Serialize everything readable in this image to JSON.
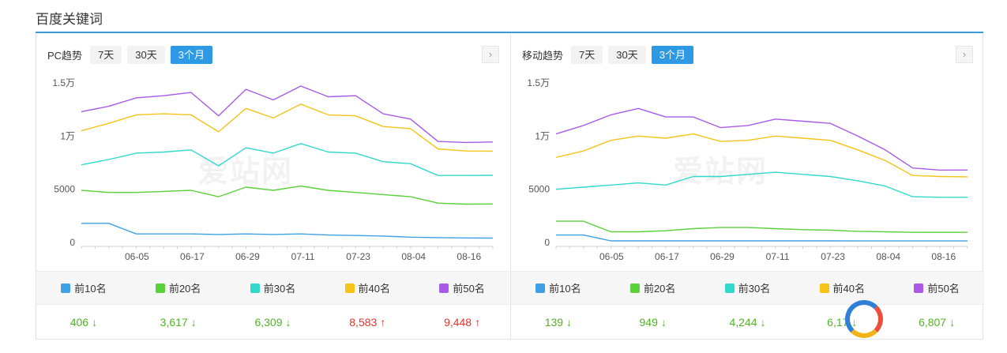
{
  "section": {
    "title": "百度关键词"
  },
  "panels": {
    "pc": {
      "label": "PC趋势",
      "ranges": [
        "7天",
        "30天",
        "3个月"
      ],
      "active_range": "3个月",
      "next_icon": "chevron-right-icon",
      "watermark": "爱站网",
      "legend": [
        "前10名",
        "前20名",
        "前30名",
        "前40名",
        "前50名"
      ],
      "values": [
        {
          "value": "406",
          "trend": "down"
        },
        {
          "value": "3,617",
          "trend": "down"
        },
        {
          "value": "6,309",
          "trend": "down"
        },
        {
          "value": "8,583",
          "trend": "up"
        },
        {
          "value": "9,448",
          "trend": "up"
        }
      ]
    },
    "mobile": {
      "label": "移动趋势",
      "ranges": [
        "7天",
        "30天",
        "3个月"
      ],
      "active_range": "3个月",
      "next_icon": "chevron-right-icon",
      "watermark": "爱站网",
      "legend": [
        "前10名",
        "前20名",
        "前30名",
        "前40名",
        "前50名"
      ],
      "values": [
        {
          "value": "139",
          "trend": "down"
        },
        {
          "value": "949",
          "trend": "down"
        },
        {
          "value": "4,244",
          "trend": "down"
        },
        {
          "value": "6,17",
          "trend": "down"
        },
        {
          "value": "6,807",
          "trend": "down"
        }
      ]
    }
  },
  "colors": {
    "top10": "#3fa0e6",
    "top20": "#5ad03a",
    "top30": "#33d8cc",
    "top40": "#f6c318",
    "top50": "#a95ae6",
    "down": "#52b226",
    "up": "#e8312a",
    "active": "#2e9ae6"
  },
  "chart_data": [
    {
      "type": "line",
      "title": "PC趋势",
      "x_ticks": [
        "06-05",
        "06-17",
        "06-29",
        "07-11",
        "07-23",
        "08-04",
        "08-16"
      ],
      "y_ticks": [
        "0",
        "5000",
        "1万",
        "1.5万"
      ],
      "ylim": [
        0,
        15000
      ],
      "x": [
        0,
        6,
        12,
        18,
        24,
        30,
        36,
        42,
        48,
        54,
        60,
        66,
        72,
        78,
        84,
        90
      ],
      "series": [
        {
          "name": "前10名",
          "values": [
            1800,
            1800,
            800,
            800,
            800,
            750,
            800,
            750,
            800,
            700,
            650,
            600,
            500,
            450,
            420,
            406
          ]
        },
        {
          "name": "前20名",
          "values": [
            4900,
            4700,
            4700,
            4800,
            4900,
            4300,
            5200,
            4900,
            5300,
            4900,
            4700,
            4500,
            4300,
            3700,
            3600,
            3617
          ]
        },
        {
          "name": "前30名",
          "values": [
            7300,
            7800,
            8400,
            8500,
            8700,
            7200,
            8900,
            8400,
            9300,
            8500,
            8400,
            7600,
            7400,
            6300,
            6300,
            6309
          ]
        },
        {
          "name": "前40名",
          "values": [
            10500,
            11200,
            12000,
            12100,
            12000,
            10400,
            12600,
            11700,
            13000,
            12000,
            11900,
            10900,
            10700,
            8800,
            8600,
            8583
          ]
        },
        {
          "name": "前50名",
          "values": [
            12300,
            12800,
            13600,
            13800,
            14100,
            11900,
            14400,
            13400,
            14700,
            13700,
            13800,
            12100,
            11600,
            9500,
            9400,
            9448
          ]
        }
      ]
    },
    {
      "type": "line",
      "title": "移动趋势",
      "x_ticks": [
        "06-05",
        "06-17",
        "06-29",
        "07-11",
        "07-23",
        "08-04",
        "08-16"
      ],
      "y_ticks": [
        "0",
        "5000",
        "1万",
        "1.5万"
      ],
      "ylim": [
        0,
        15000
      ],
      "x": [
        0,
        6,
        12,
        18,
        24,
        30,
        36,
        42,
        48,
        54,
        60,
        66,
        72,
        78,
        84,
        90
      ],
      "series": [
        {
          "name": "前10名",
          "values": [
            700,
            700,
            150,
            150,
            150,
            150,
            150,
            150,
            150,
            150,
            150,
            140,
            140,
            140,
            139,
            139
          ]
        },
        {
          "name": "前20名",
          "values": [
            2000,
            2000,
            1000,
            1000,
            1100,
            1300,
            1400,
            1400,
            1300,
            1200,
            1150,
            1050,
            1000,
            950,
            950,
            949
          ]
        },
        {
          "name": "前30名",
          "values": [
            5000,
            5200,
            5400,
            5600,
            5400,
            6200,
            6200,
            6400,
            6600,
            6400,
            6200,
            5800,
            5300,
            4300,
            4250,
            4244
          ]
        },
        {
          "name": "前40名",
          "values": [
            8000,
            8600,
            9600,
            10000,
            9800,
            10200,
            9500,
            9600,
            10000,
            9800,
            9600,
            8700,
            7700,
            6300,
            6200,
            6170
          ]
        },
        {
          "name": "前50名",
          "values": [
            10200,
            11000,
            12000,
            12600,
            11800,
            11800,
            10800,
            11000,
            11600,
            11400,
            11200,
            10000,
            8700,
            7000,
            6800,
            6807
          ]
        }
      ]
    }
  ]
}
